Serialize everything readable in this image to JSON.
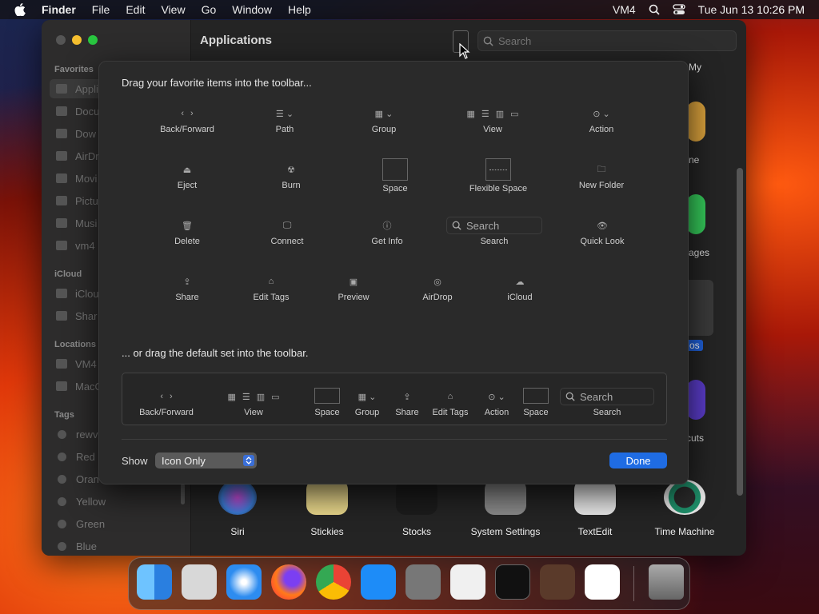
{
  "menubar": {
    "app_name": "Finder",
    "menus": [
      "File",
      "Edit",
      "View",
      "Go",
      "Window",
      "Help"
    ],
    "user": "VM4",
    "datetime": "Tue Jun 13  10:26 PM"
  },
  "window": {
    "title": "Applications",
    "search_placeholder": "Search"
  },
  "sidebar": {
    "sections": {
      "favorites": "Favorites",
      "icloud": "iCloud",
      "locations": "Locations",
      "tags": "Tags"
    },
    "favorites": [
      "Appli",
      "Docu",
      "Dow",
      "AirDr",
      "Movi",
      "Pictu",
      "Musi",
      "vm4"
    ],
    "icloud": [
      "iClou",
      "Shar"
    ],
    "locations": [
      "VM4",
      "MacO"
    ],
    "tags": [
      "rewv",
      "Red",
      "Oran",
      "Yellow",
      "Green",
      "Blue"
    ]
  },
  "right_labels": {
    "my": "My",
    "ne": "ne",
    "ages": "ages",
    "os": "os",
    "cuts": "cuts"
  },
  "apps_row": [
    "Siri",
    "Stickies",
    "Stocks",
    "System Settings",
    "TextEdit",
    "Time Machine"
  ],
  "customize": {
    "heading_items": "Drag your favorite items into the toolbar...",
    "heading_default": "... or drag the default set into the toolbar.",
    "items": {
      "back_forward": "Back/Forward",
      "path": "Path",
      "group": "Group",
      "view": "View",
      "action": "Action",
      "eject": "Eject",
      "burn": "Burn",
      "space": "Space",
      "flexible_space": "Flexible Space",
      "new_folder": "New Folder",
      "delete": "Delete",
      "connect": "Connect",
      "get_info": "Get Info",
      "search": "Search",
      "search_field": "Search",
      "quick_look": "Quick Look",
      "share": "Share",
      "edit_tags": "Edit Tags",
      "preview": "Preview",
      "airdrop": "AirDrop",
      "icloud": "iCloud"
    },
    "default_set": {
      "back_forward": "Back/Forward",
      "view": "View",
      "space1": "Space",
      "group": "Group",
      "share": "Share",
      "edit_tags": "Edit Tags",
      "action": "Action",
      "space2": "Space",
      "search": "Search",
      "search_field": "Search"
    },
    "show_label": "Show",
    "show_value": "Icon Only",
    "done_label": "Done"
  },
  "dock": [
    "finder-icon",
    "launchpad-icon",
    "safari-icon",
    "firefox-icon",
    "chrome-icon",
    "app-store-icon",
    "system-settings-icon",
    "textedit-icon",
    "terminal-icon",
    "garageband-icon",
    "vscode-icon",
    "trash-icon"
  ]
}
